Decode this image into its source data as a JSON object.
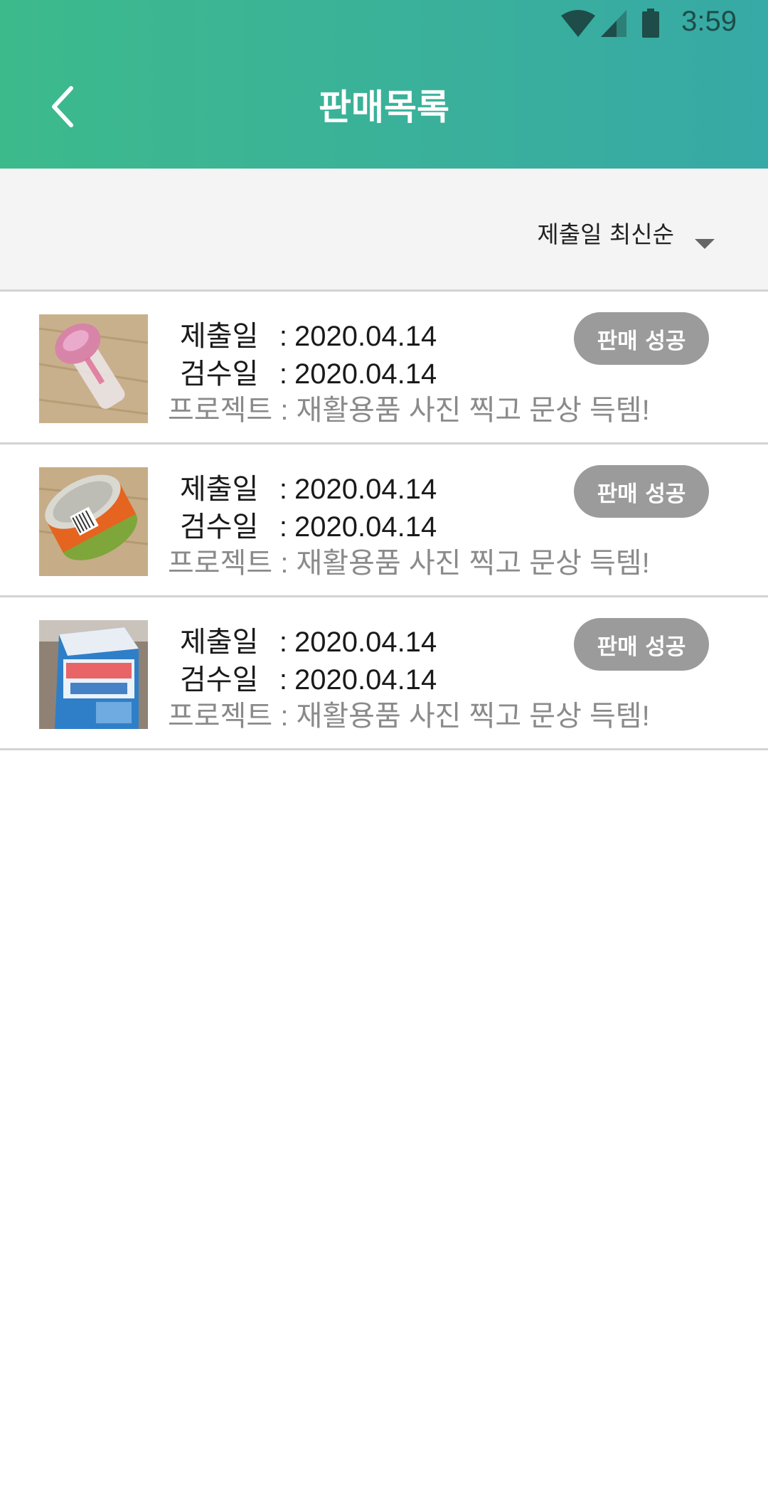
{
  "status_bar": {
    "time": "3:59"
  },
  "header": {
    "title": "판매목록"
  },
  "sort": {
    "label": "제출일 최신순"
  },
  "items": [
    {
      "submit_label": "제출일",
      "submit_date": "2020.04.14",
      "review_label": "검수일",
      "review_date": "2020.04.14",
      "project_label": "프로젝트",
      "project_name": "재활용품 사진 찍고 문상 득템!",
      "status": "판매 성공",
      "thumb": "plastic-cup"
    },
    {
      "submit_label": "제출일",
      "submit_date": "2020.04.14",
      "review_label": "검수일",
      "review_date": "2020.04.14",
      "project_label": "프로젝트",
      "project_name": "재활용품 사진 찍고 문상 득템!",
      "status": "판매 성공",
      "thumb": "tuna-can"
    },
    {
      "submit_label": "제출일",
      "submit_date": "2020.04.14",
      "review_label": "검수일",
      "review_date": "2020.04.14",
      "project_label": "프로젝트",
      "project_name": "재활용품 사진 찍고 문상 득템!",
      "status": "판매 성공",
      "thumb": "milk-carton"
    }
  ],
  "colors": {
    "header_start": "#3dba8c",
    "header_end": "#37a9a6",
    "badge": "#9b9b9b"
  }
}
